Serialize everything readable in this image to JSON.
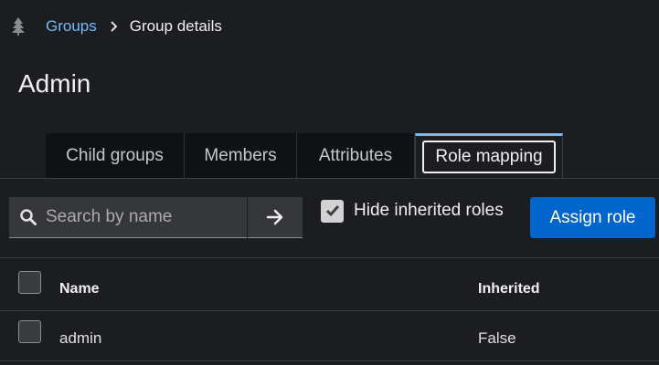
{
  "breadcrumb": {
    "icon": "tree-icon",
    "link": "Groups",
    "current": "Group details"
  },
  "title": "Admin",
  "tabs": [
    {
      "label": "Child groups"
    },
    {
      "label": "Members"
    },
    {
      "label": "Attributes"
    },
    {
      "label": "Role mapping",
      "active": true
    }
  ],
  "toolbar": {
    "search_placeholder": "Search by name",
    "hide_inherited_label": "Hide inherited roles",
    "hide_inherited_checked": true,
    "assign_label": "Assign role"
  },
  "table": {
    "columns": [
      "Name",
      "Inherited"
    ],
    "rows": [
      {
        "name": "admin",
        "inherited": "False"
      }
    ]
  },
  "colors": {
    "accent": "#73bcf7",
    "primary_button": "#0066cc",
    "background": "#1b1d21"
  }
}
